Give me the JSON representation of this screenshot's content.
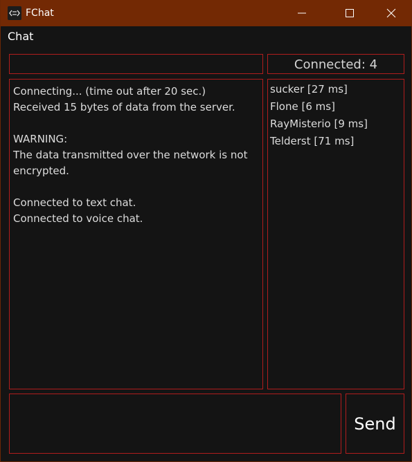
{
  "window": {
    "title": "FChat"
  },
  "menu": {
    "chat_label": "Chat"
  },
  "status": {
    "connected_label": "Connected: 4"
  },
  "log": {
    "lines": [
      "Connecting... (time out after 20 sec.)",
      "Received 15 bytes of data from the server.",
      "",
      "WARNING:",
      "The data transmitted over the network is not encrypted.",
      "",
      "Connected to text chat.",
      "Connected to voice chat."
    ]
  },
  "users": {
    "items": [
      "sucker [27 ms]",
      "Flone [6 ms]",
      "RayMisterio [9 ms]",
      "Telderst [71 ms]"
    ]
  },
  "input": {
    "send_label": "Send",
    "top_field_value": "",
    "message_value": ""
  },
  "icons": {
    "app": "chat-app-icon",
    "minimize": "minimize-icon",
    "maximize": "maximize-icon",
    "close": "close-icon"
  },
  "colors": {
    "titlebar": "#732904",
    "border": "#b11d1d",
    "background": "#141414"
  }
}
